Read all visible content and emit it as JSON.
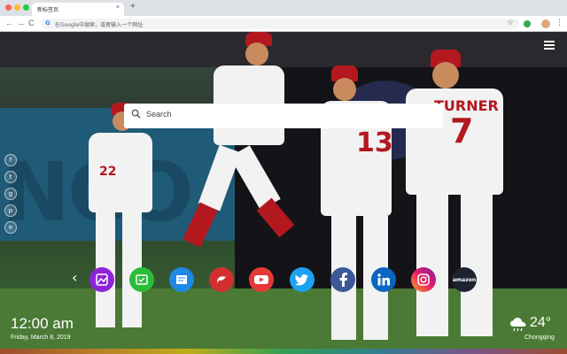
{
  "browser": {
    "tab_title": "新标签页",
    "tab_close": "×",
    "new_tab": "+",
    "omnibox_placeholder": "在Google中搜索，或者输入一个网址",
    "nav": {
      "back": "←",
      "forward": "→",
      "reload": "C"
    },
    "google_letter": "G",
    "star": "☆",
    "menu": "⋮"
  },
  "search": {
    "placeholder": "Search"
  },
  "background": {
    "wall_text": "NCO",
    "numbers": [
      "22",
      "13",
      "7"
    ],
    "name_bar": "TURNER"
  },
  "side_social": [
    "f",
    "t",
    "g",
    "p",
    "e"
  ],
  "dock": {
    "arrow_left": "‹",
    "arrow_right": "›",
    "items": [
      {
        "name": "photos",
        "color": "#8e24d8"
      },
      {
        "name": "check-mail",
        "color": "#2bbd3a"
      },
      {
        "name": "notes",
        "color": "#1e88e5"
      },
      {
        "name": "games",
        "color": "#d32f2f"
      },
      {
        "name": "youtube",
        "color": "#e53935"
      },
      {
        "name": "twitter",
        "color": "#1da1f2"
      },
      {
        "name": "facebook",
        "color": "#3b5998"
      },
      {
        "name": "linkedin",
        "color": "#0a66c2"
      },
      {
        "name": "instagram",
        "color": "#d6249f"
      },
      {
        "name": "amazon",
        "color": "#1b2330",
        "label": "amazon"
      }
    ]
  },
  "clock": {
    "time": "12:00 am",
    "date": "Friday, March 8, 2019"
  },
  "weather": {
    "temp": "24°",
    "city": "Chongqing",
    "icon": "cloud-rain-icon"
  }
}
